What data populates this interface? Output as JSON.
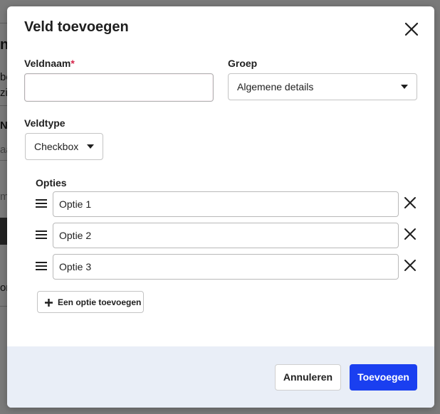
{
  "background": {
    "fragments": [
      "ne",
      "bo",
      "zic",
      "N",
      "aa",
      "m",
      "on"
    ]
  },
  "dialog": {
    "title": "Veld toevoegen",
    "close_icon": "close-icon"
  },
  "fields": {
    "name_label": "Veldnaam",
    "required_mark": "*",
    "name_value": "",
    "group_label": "Groep",
    "group_value": "Algemene details",
    "type_label": "Veldtype",
    "type_value": "Checkbox"
  },
  "options": {
    "label": "Opties",
    "items": [
      {
        "value": "Optie 1"
      },
      {
        "value": "Optie 2"
      },
      {
        "value": "Optie 3"
      }
    ],
    "add_label": "Een optie toevoegen"
  },
  "footer": {
    "cancel_label": "Annuleren",
    "submit_label": "Toevoegen"
  },
  "colors": {
    "accent": "#1a3ff0",
    "required": "#d6264b",
    "footer_bg": "#e9eef7",
    "overlay": "#6f6f6f"
  }
}
